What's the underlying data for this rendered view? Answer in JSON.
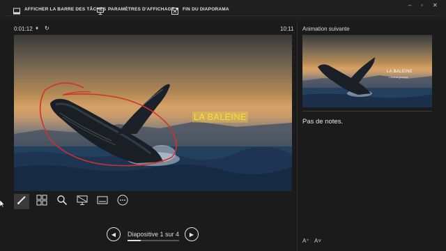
{
  "toolbar": {
    "taskbar_label": "AFFICHER LA BARRE DES TÂCHES",
    "display_settings_label": "PARAMÈTRES D'AFFICHAGE ▾",
    "end_show_label": "FIN DU DIAPORAMA"
  },
  "window_controls": {
    "minimize": "–",
    "restore": "▫",
    "close": "✕"
  },
  "presenter": {
    "timer": "0:01:12",
    "pause_glyph": "⏸",
    "reset_glyph": "↻",
    "clock": "10:11"
  },
  "slide": {
    "title": "LA BALEINE"
  },
  "next": {
    "label": "Animation suivante",
    "thumb_title": "LA BALEINE",
    "thumb_subtitle": "L'Animal gracieux"
  },
  "notes": {
    "text": "Pas de notes."
  },
  "navigation": {
    "prev_glyph": "◀",
    "next_glyph": "▶",
    "label": "Diapositive 1 sur 4",
    "progress": 0.25
  },
  "font_controls": {
    "increase": "A⁺",
    "decrease": "A˅"
  },
  "icons": [
    "pen-tool-icon",
    "all-slides-icon",
    "zoom-icon",
    "black-screen-icon",
    "subtitles-icon",
    "more-options-icon"
  ],
  "colors": {
    "background": "#1b1b1b",
    "highlight": "#f5e13b",
    "annotation": "#d6302a"
  }
}
